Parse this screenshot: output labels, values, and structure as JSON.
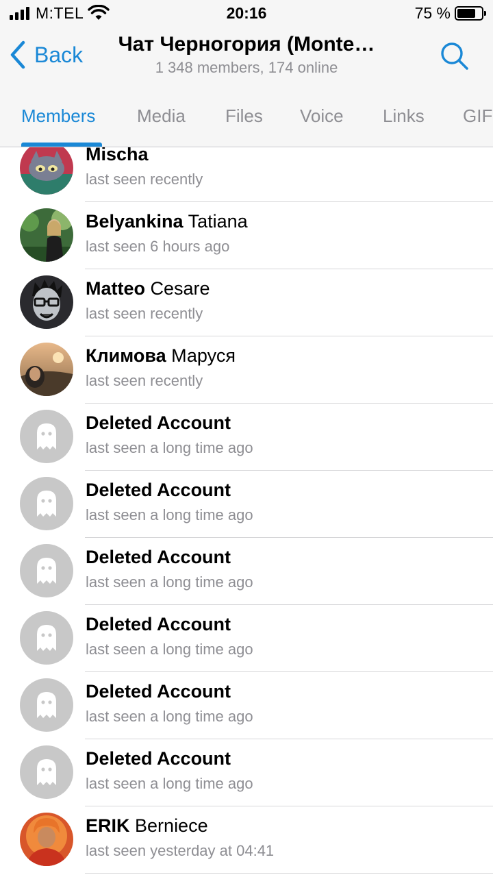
{
  "status_bar": {
    "carrier": "M:TEL",
    "time": "20:16",
    "battery_pct": "75 %",
    "battery_level": 0.75
  },
  "nav": {
    "back_label": "Back",
    "title": "Чат Черногория (Monte…",
    "subtitle": "1 348 members, 174 online"
  },
  "tabs": [
    {
      "label": "Members",
      "active": true
    },
    {
      "label": "Media",
      "active": false
    },
    {
      "label": "Files",
      "active": false
    },
    {
      "label": "Voice",
      "active": false
    },
    {
      "label": "Links",
      "active": false
    },
    {
      "label": "GIFs",
      "active": false
    }
  ],
  "members": [
    {
      "first": "Mischa",
      "last": "",
      "status": "last seen recently",
      "avatar": "photo-cat"
    },
    {
      "first": "Belyankina",
      "last": "Tatiana",
      "status": "last seen 6 hours ago",
      "avatar": "photo-garden"
    },
    {
      "first": "Matteo",
      "last": "Cesare",
      "status": "last seen recently",
      "avatar": "photo-cartoon-face"
    },
    {
      "first": "Климова",
      "last": "Маруся",
      "status": "last seen recently",
      "avatar": "photo-sunset"
    },
    {
      "first": "Deleted Account",
      "last": "",
      "status": "last seen a long time ago",
      "avatar": "ghost-icon"
    },
    {
      "first": "Deleted Account",
      "last": "",
      "status": "last seen a long time ago",
      "avatar": "ghost-icon"
    },
    {
      "first": "Deleted Account",
      "last": "",
      "status": "last seen a long time ago",
      "avatar": "ghost-icon"
    },
    {
      "first": "Deleted Account",
      "last": "",
      "status": "last seen a long time ago",
      "avatar": "ghost-icon"
    },
    {
      "first": "Deleted Account",
      "last": "",
      "status": "last seen a long time ago",
      "avatar": "ghost-icon"
    },
    {
      "first": "Deleted Account",
      "last": "",
      "status": "last seen a long time ago",
      "avatar": "ghost-icon"
    },
    {
      "first": "ERIK",
      "last": "Berniece",
      "status": "last seen yesterday at 04:41",
      "avatar": "photo-monk"
    }
  ],
  "colors": {
    "accent": "#1a88d6",
    "secondary_text": "#8e8e93",
    "bar_background": "#f6f6f6"
  }
}
